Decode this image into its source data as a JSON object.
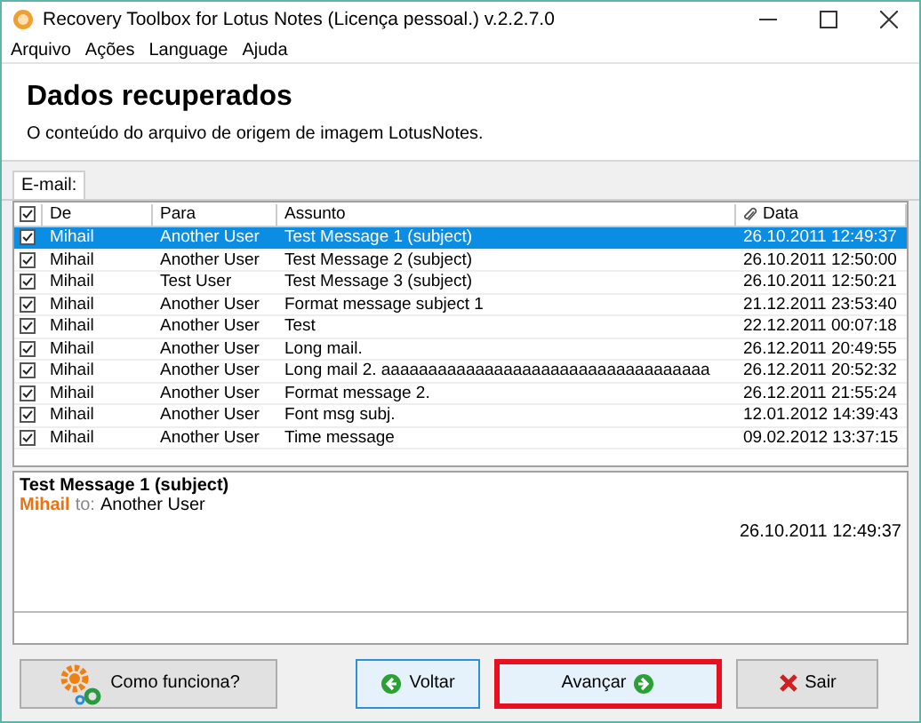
{
  "window": {
    "title": "Recovery Toolbox for Lotus Notes (Licença pessoal.) v.2.2.7.0"
  },
  "menu": [
    "Arquivo",
    "Ações",
    "Language",
    "Ajuda"
  ],
  "header": {
    "title": "Dados recuperados",
    "subtitle": "O conteúdo do arquivo de origem de imagem LotusNotes."
  },
  "tabs": [
    {
      "label": "E-mail:",
      "selected": true
    }
  ],
  "table": {
    "all_checked": true,
    "columns": [
      "De",
      "Para",
      "Assunto",
      "Data"
    ],
    "rows": [
      {
        "checked": true,
        "selected": true,
        "from": "Mihail",
        "to": "Another User",
        "subject": "Test Message 1 (subject)",
        "date": "26.10.2011 12:49:37"
      },
      {
        "checked": true,
        "selected": false,
        "from": "Mihail",
        "to": "Another User",
        "subject": "Test Message 2 (subject)",
        "date": "26.10.2011 12:50:00"
      },
      {
        "checked": true,
        "selected": false,
        "from": "Mihail",
        "to": "Test User",
        "subject": "Test Message 3 (subject)",
        "date": "26.10.2011 12:50:21"
      },
      {
        "checked": true,
        "selected": false,
        "from": "Mihail",
        "to": "Another User",
        "subject": "Format message subject 1",
        "date": "21.12.2011 23:53:40"
      },
      {
        "checked": true,
        "selected": false,
        "from": "Mihail",
        "to": "Another User",
        "subject": "Test",
        "date": "22.12.2011 00:07:18"
      },
      {
        "checked": true,
        "selected": false,
        "from": "Mihail",
        "to": "Another User",
        "subject": "Long mail.",
        "date": "26.12.2011 20:49:55"
      },
      {
        "checked": true,
        "selected": false,
        "from": "Mihail",
        "to": "Another User",
        "subject": "Long mail 2. aaaaaaaaaaaaaaaaaaaaaaaaaaaaaaaaaaa",
        "date": "26.12.2011 20:52:32"
      },
      {
        "checked": true,
        "selected": false,
        "from": "Mihail",
        "to": "Another User",
        "subject": "Format message 2.",
        "date": "26.12.2011 21:55:24"
      },
      {
        "checked": true,
        "selected": false,
        "from": "Mihail",
        "to": "Another User",
        "subject": "Font msg subj.",
        "date": "12.01.2012 14:39:43"
      },
      {
        "checked": true,
        "selected": false,
        "from": "Mihail",
        "to": "Another User",
        "subject": "Time message",
        "date": "09.02.2012 13:37:15"
      }
    ]
  },
  "preview": {
    "subject": "Test Message 1 (subject)",
    "from": "Mihail",
    "to_label": "to:",
    "to": "Another User",
    "date": "26.10.2011 12:49:37"
  },
  "buttons": [
    {
      "kind": "help",
      "label": "Como funciona?",
      "highlighted": false,
      "focused": false
    },
    {
      "kind": "back",
      "label": "Voltar",
      "highlighted": false,
      "focused": true
    },
    {
      "kind": "next",
      "label": "Avançar",
      "highlighted": true,
      "focused": false
    },
    {
      "kind": "exit",
      "label": "Sair",
      "highlighted": false,
      "focused": false
    }
  ]
}
